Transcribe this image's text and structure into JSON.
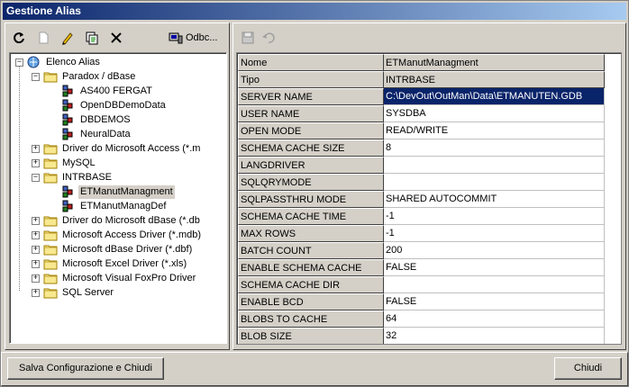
{
  "window": {
    "title": "Gestione Alias"
  },
  "toolbar_left": {
    "odbc_label": "Odbc...",
    "icons": [
      "refresh-icon",
      "new-icon",
      "edit-icon",
      "copy-icon",
      "delete-icon",
      "odbc-icon"
    ]
  },
  "toolbar_right": {
    "icons": [
      "save-icon",
      "undo-icon"
    ]
  },
  "tree": {
    "root": "Elenco Alias",
    "groups": [
      {
        "label": "Paradox / dBase",
        "expanded": true,
        "children": [
          "AS400 FERGAT",
          "OpenDBDemoData",
          "DBDEMOS",
          "NeuralData"
        ]
      },
      {
        "label": "Driver do Microsoft Access (*.m",
        "expanded": false
      },
      {
        "label": "MySQL",
        "expanded": false
      },
      {
        "label": "INTRBASE",
        "expanded": true,
        "children": [
          "ETManutManagment",
          "ETManutManagDef"
        ]
      },
      {
        "label": "Driver do Microsoft dBase (*.db",
        "expanded": false
      },
      {
        "label": "Microsoft Access Driver (*.mdb)",
        "expanded": false
      },
      {
        "label": "Microsoft dBase Driver (*.dbf)",
        "expanded": false
      },
      {
        "label": "Microsoft Excel Driver (*.xls)",
        "expanded": false
      },
      {
        "label": "Microsoft Visual FoxPro Driver",
        "expanded": false
      },
      {
        "label": "SQL Server",
        "expanded": false
      }
    ],
    "selected": "ETManutManagment"
  },
  "properties": [
    {
      "key": "Nome",
      "value": "ETManutManagment"
    },
    {
      "key": "Tipo",
      "value": "INTRBASE"
    },
    {
      "key": "SERVER NAME",
      "value": "C:\\DevOut\\OutMan\\Data\\ETMANUTEN.GDB"
    },
    {
      "key": "USER NAME",
      "value": "SYSDBA"
    },
    {
      "key": "OPEN MODE",
      "value": "READ/WRITE"
    },
    {
      "key": "SCHEMA CACHE SIZE",
      "value": "8"
    },
    {
      "key": "LANGDRIVER",
      "value": ""
    },
    {
      "key": "SQLQRYMODE",
      "value": ""
    },
    {
      "key": "SQLPASSTHRU MODE",
      "value": "SHARED AUTOCOMMIT"
    },
    {
      "key": "SCHEMA CACHE TIME",
      "value": "-1"
    },
    {
      "key": "MAX ROWS",
      "value": "-1"
    },
    {
      "key": "BATCH COUNT",
      "value": "200"
    },
    {
      "key": "ENABLE SCHEMA CACHE",
      "value": "FALSE"
    },
    {
      "key": "SCHEMA CACHE DIR",
      "value": ""
    },
    {
      "key": "ENABLE BCD",
      "value": "FALSE"
    },
    {
      "key": "BLOBS TO CACHE",
      "value": "64"
    },
    {
      "key": "BLOB SIZE",
      "value": "32"
    }
  ],
  "buttons": {
    "save": "Salva Configurazione e Chiudi",
    "close": "Chiudi"
  },
  "colors": {
    "title_start": "#0a246a",
    "title_end": "#a6caf0",
    "face": "#d4d0c8",
    "selection": "#0a246a"
  }
}
